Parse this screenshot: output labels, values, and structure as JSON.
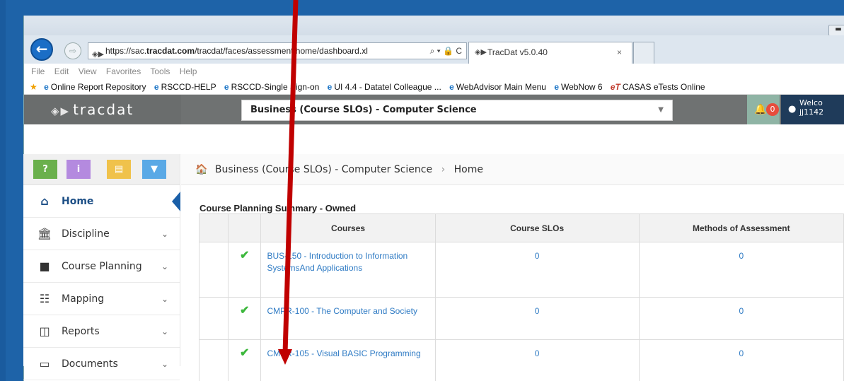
{
  "browser": {
    "url_prefix": "https://sac.",
    "url_domain": "tracdat.com",
    "url_rest": "/tracdat/faces/assessment/home/dashboard.xl",
    "url_tools": "⌕ ▾ 🔒 C",
    "tab_title": "TracDat v5.0.40",
    "tab_close": "×",
    "menu": [
      "File",
      "Edit",
      "View",
      "Favorites",
      "Tools",
      "Help"
    ],
    "favorites": [
      "Online Report Repository",
      "RSCCD-HELP",
      "RSCCD-Single Sign-on",
      "UI 4.4 - Datatel Colleague ...",
      "WebAdvisor Main Menu",
      "WebNow 6",
      "CASAS eTests Online"
    ]
  },
  "app": {
    "logo_text": "tracdat",
    "unit_selector": "Business (Course SLOs) - Computer Science",
    "notification_count": "0",
    "welcome_text": "Welco",
    "user_id": "jj1142"
  },
  "sidebar": {
    "toolbar": [
      {
        "label": "?",
        "color": "#6ab04c"
      },
      {
        "label": "i",
        "color": "#b48adf"
      },
      {
        "label": "▤",
        "color": "#f0c24b"
      },
      {
        "label": "▼",
        "color": "#5aa9e6"
      }
    ],
    "items": [
      {
        "label": "Home",
        "icon": "home-icon",
        "glyph": "⌂",
        "chevron": ""
      },
      {
        "label": "Discipline",
        "icon": "institution-icon",
        "glyph": "⌂",
        "chevron": "⌄"
      },
      {
        "label": "Course Planning",
        "icon": "book-icon",
        "glyph": "■",
        "chevron": "⌄"
      },
      {
        "label": "Mapping",
        "icon": "sitemap-icon",
        "glyph": "☷",
        "chevron": "⌄"
      },
      {
        "label": "Reports",
        "icon": "columns-icon",
        "glyph": "◫",
        "chevron": "⌄"
      },
      {
        "label": "Documents",
        "icon": "folder-icon",
        "glyph": "▭",
        "chevron": "⌄"
      }
    ]
  },
  "breadcrumb": {
    "unit": "Business (Course SLOs) - Computer Science",
    "separator": "›",
    "page": "Home"
  },
  "summary": {
    "title": "Course Planning Summary - Owned",
    "headers": [
      "Courses",
      "Course SLOs",
      "Methods of Assessment"
    ],
    "rows": [
      {
        "course": "BUS-150 - Introduction to Information SystemsAnd Applications",
        "course_slos": "0",
        "methods": "0"
      },
      {
        "course": "CMPR-100 - The Computer and Society",
        "course_slos": "0",
        "methods": "0"
      },
      {
        "course": "CMPR-105 - Visual BASIC Programming",
        "course_slos": "0",
        "methods": "0"
      }
    ]
  },
  "annotation": {
    "arrow_color": "#c00000"
  }
}
